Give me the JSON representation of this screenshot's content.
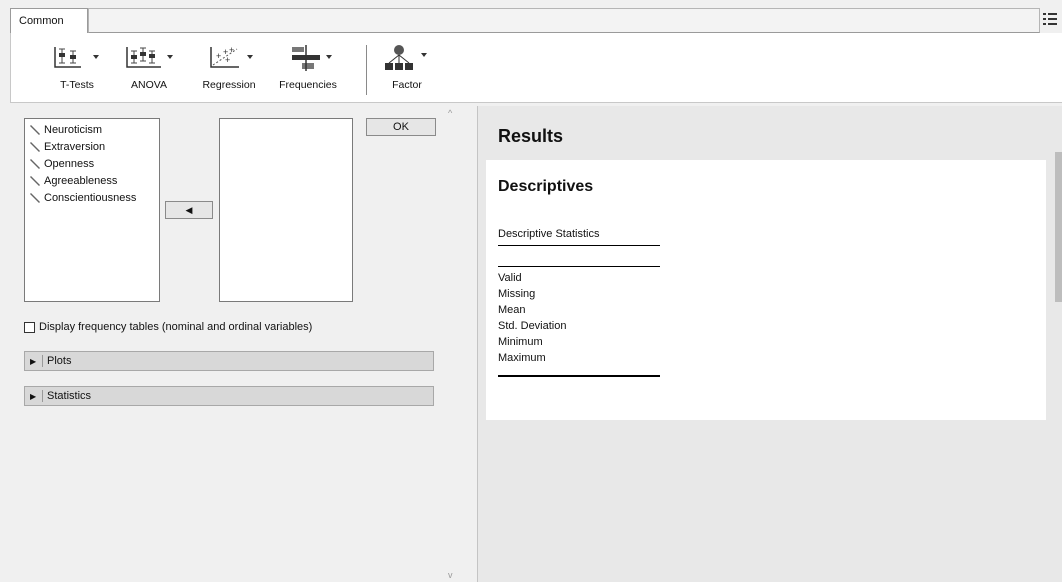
{
  "tabs": [
    {
      "label": "Common"
    }
  ],
  "ribbon": {
    "buttons": [
      {
        "label": "T-Tests",
        "icon": "ttests-icon"
      },
      {
        "label": "ANOVA",
        "icon": "anova-icon"
      },
      {
        "label": "Regression",
        "icon": "regression-icon"
      },
      {
        "label": "Frequencies",
        "icon": "frequencies-icon"
      },
      {
        "label": "Factor",
        "icon": "factor-icon"
      }
    ]
  },
  "variables": [
    {
      "label": "Neuroticism"
    },
    {
      "label": "Extraversion"
    },
    {
      "label": "Openness"
    },
    {
      "label": "Agreeableness"
    },
    {
      "label": "Conscientiousness"
    }
  ],
  "move_button": {
    "label": "◀"
  },
  "ok_button": {
    "label": "OK"
  },
  "frequency_tables": {
    "label": "Display frequency tables (nominal and ordinal variables)",
    "checked": false
  },
  "sections": [
    {
      "label": "Plots",
      "expanded": false
    },
    {
      "label": "Statistics",
      "expanded": false
    }
  ],
  "results": {
    "title": "Results",
    "heading": "Descriptives",
    "table_caption": "Descriptive Statistics",
    "rows": [
      "Valid",
      "Missing",
      "Mean",
      "Std. Deviation",
      "Minimum",
      "Maximum"
    ]
  },
  "colors": {
    "panel_bg": "#f0f0f0",
    "results_bg": "#e8e8e8",
    "section_bg": "#d8d8d8"
  }
}
